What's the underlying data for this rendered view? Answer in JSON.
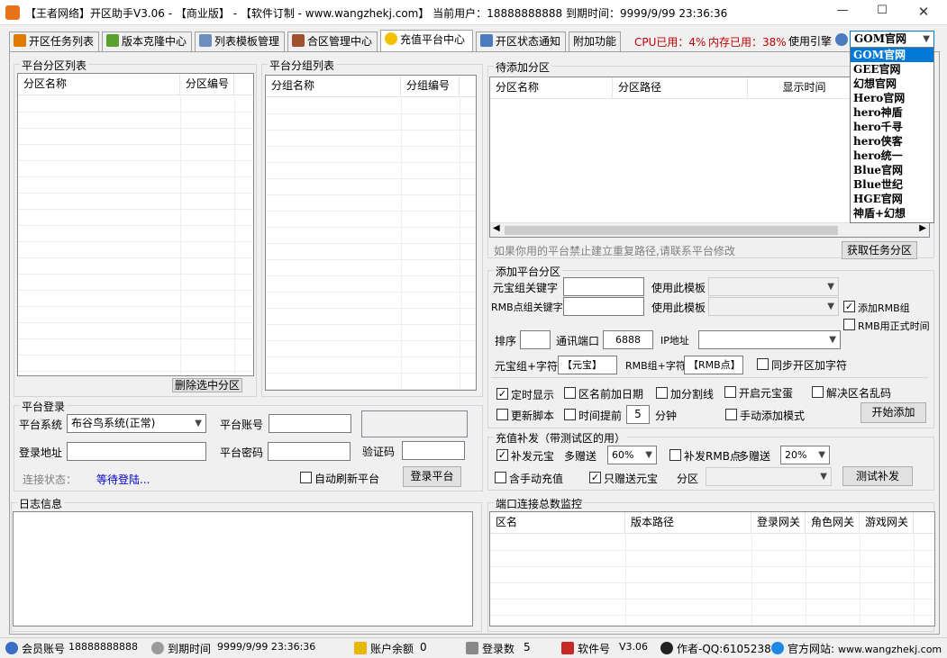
{
  "window": {
    "title": "【王者网络】开区助手V3.06 - 【商业版】 - 【软件订制 - www.wangzhekj.com】 当前用户：18888888888   到期时间：9999/9/99 23:36:36",
    "min": "—",
    "max": "☐",
    "close": "✕"
  },
  "tabs": [
    "开区任务列表",
    "版本克隆中心",
    "列表模板管理",
    "合区管理中心",
    "充值平台中心",
    "开区状态通知",
    "附加功能"
  ],
  "sysinfo": {
    "cpu": "CPU已用：4%",
    "mem": "内存已用：38%",
    "engine_label": "使用引擎",
    "engine_value": "GOM官网"
  },
  "engine_options": [
    "GOM官网",
    "GEE官网",
    "幻想官网",
    "Hero官网",
    "hero神盾",
    "hero千寻",
    "hero侠客",
    "hero统一",
    "Blue官网",
    "Blue世纪",
    "HGE官网",
    "神盾+幻想"
  ],
  "platform_zone_list": {
    "title": "平台分区列表",
    "col1": "分区名称",
    "col2": "分区编号",
    "delete_btn": "删除选中分区"
  },
  "platform_group_list": {
    "title": "平台分组列表",
    "col1": "分组名称",
    "col2": "分组编号"
  },
  "pending": {
    "title": "待添加分区",
    "col1": "分区名称",
    "col2": "分区路径",
    "col3": "显示时间",
    "hint": "如果你用的平台禁止建立重复路径,请联系平台修改",
    "fetch_btn": "获取任务分区"
  },
  "add_zone": {
    "title": "添加平台分区",
    "yb_key_label": "元宝组关键字",
    "use_tpl1": "使用此模板",
    "rmb_key_label": "RMB点组关键字",
    "use_tpl2": "使用此模板",
    "add_rmb_group": "添加RMB组",
    "rmb_formal_time": "RMB用正式时间",
    "sort_label": "排序",
    "port_label": "通讯端口",
    "port_value": "6888",
    "ip_label": "IP地址",
    "yb_suffix_label": "元宝组+字符",
    "yb_suffix_value": "【元宝】",
    "rmb_suffix_label": "RMB组+字符",
    "rmb_suffix_value": "【RMB点】",
    "sync_suffix": "同步开区加字符",
    "timed_show": "定时显示",
    "date_before_name": "区名前加日期",
    "split_line": "加分割线",
    "open_yb_egg": "开启元宝蛋",
    "fix_garbled": "解决区名乱码",
    "update_script": "更新脚本",
    "time_ahead": "时间提前",
    "ahead_value": "5",
    "minutes": "分钟",
    "manual_add": "手动添加模式",
    "start_btn": "开始添加"
  },
  "recharge": {
    "title": "充值补发（带测试区的用）",
    "resend_yb": "补发元宝",
    "extra_label1": "多赠送",
    "extra_value1": "60%",
    "resend_rmb": "补发RMB点",
    "extra_label2": "多赠送",
    "extra_value2": "20%",
    "include_manual": "含手动充值",
    "only_yb": "只赠送元宝",
    "zone_label": "分区",
    "test_btn": "测试补发"
  },
  "login": {
    "title": "平台登录",
    "system_label": "平台系统",
    "system_value": "布谷鸟系统(正常)",
    "account_label": "平台账号",
    "address_label": "登录地址",
    "password_label": "平台密码",
    "captcha_label": "验证码",
    "status_label": "连接状态：",
    "status_value": "等待登陆...",
    "auto_refresh": "自动刷新平台",
    "login_btn": "登录平台"
  },
  "log": {
    "title": "日志信息"
  },
  "port_monitor": {
    "title": "端口连接总数监控",
    "cols": [
      "区名",
      "版本路径",
      "登录网关",
      "角色网关",
      "游戏网关"
    ]
  },
  "statusbar": {
    "member_label": "会员账号",
    "member_value": "18888888888",
    "expire_label": "到期时间",
    "expire_value": "9999/9/99 23:36:36",
    "balance_label": "账户余额",
    "balance_value": "0",
    "logins_label": "登录数",
    "logins_value": "5",
    "soft_label": "软件号",
    "soft_value": "V3.06",
    "author": "作者-QQ:6105238",
    "site_label": "官方网站:",
    "site_value": "www.wangzhekj.com"
  },
  "colors": {
    "accent": "#0078d7",
    "status_link": "#0000cc",
    "cpu_red": "#c00000"
  }
}
